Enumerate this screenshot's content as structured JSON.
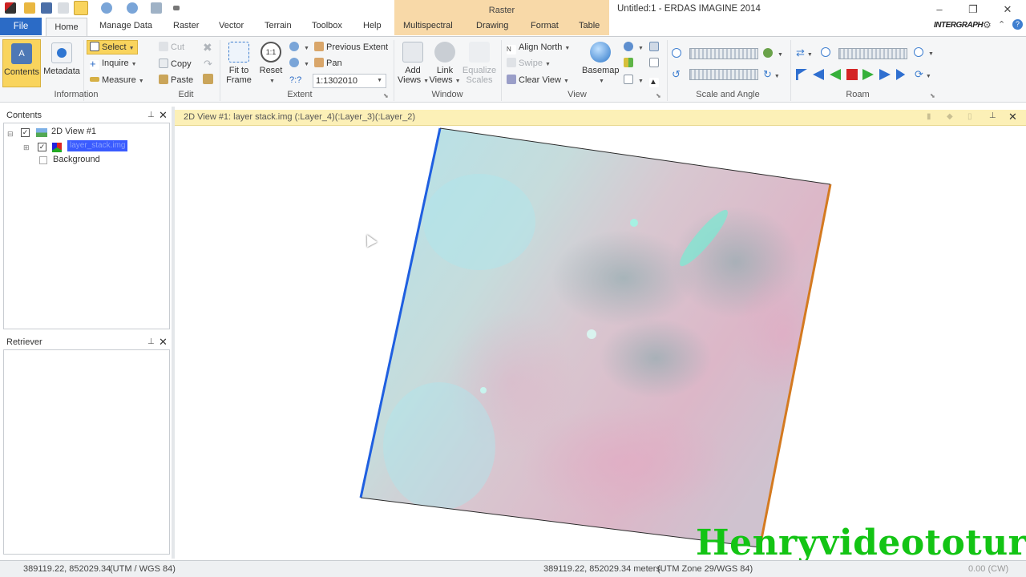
{
  "window": {
    "title": "Untitled:1 - ERDAS IMAGINE 2014",
    "context_tab_group": "Raster",
    "brand": "INTERGRAPH"
  },
  "tabs": [
    "Home",
    "Manage Data",
    "Raster",
    "Vector",
    "Terrain",
    "Toolbox",
    "Help",
    "Multispectral",
    "Drawing",
    "Format",
    "Table"
  ],
  "file_tab": "File",
  "ribbon": {
    "information": {
      "label": "Information",
      "contents": "Contents",
      "metadata": "Metadata"
    },
    "edit": {
      "label": "Edit",
      "select": "Select",
      "inquire": "Inquire",
      "measure": "Measure",
      "cut": "Cut",
      "copy": "Copy",
      "paste": "Paste"
    },
    "extent": {
      "label": "Extent",
      "fit_to_frame_1": "Fit to",
      "fit_to_frame_2": "Frame",
      "reset": "Reset",
      "previous_extent": "Previous Extent",
      "pan": "Pan",
      "scale_value": "1:1302010",
      "scale_help": "?:?"
    },
    "window": {
      "label": "Window",
      "add_views_1": "Add",
      "add_views_2": "Views",
      "link_views_1": "Link",
      "link_views_2": "Views",
      "equalize_scales_1": "Equalize",
      "equalize_scales_2": "Scales"
    },
    "view": {
      "label": "View",
      "align_north": "Align North",
      "swipe": "Swipe",
      "clear_view": "Clear View",
      "basemap": "Basemap"
    },
    "scale_and_angle": {
      "label": "Scale and Angle"
    },
    "roam": {
      "label": "Roam"
    }
  },
  "contents_panel": {
    "title": "Contents",
    "tree": {
      "view": "2D View #1",
      "layer": "layer_stack.img",
      "background": "Background"
    }
  },
  "retriever_panel": {
    "title": "Retriever"
  },
  "viewer": {
    "title": "2D View #1: layer stack.img (:Layer_4)(:Layer_3)(:Layer_2)"
  },
  "status": {
    "left_coords": "389119.22, 852029.34",
    "left_crs": "(UTM / WGS 84)",
    "right_coords": "389119.22, 852029.34 meters",
    "right_crs": "(UTM Zone 29/WGS 84)",
    "rotation": "0.00 (CW)"
  },
  "watermark": "Henryvideototur",
  "colors": {
    "file_tab": "#2b6bc6",
    "context_tab": "#f8d9a8",
    "viewer_header": "#fcf0b7",
    "watermark": "#13c414"
  }
}
